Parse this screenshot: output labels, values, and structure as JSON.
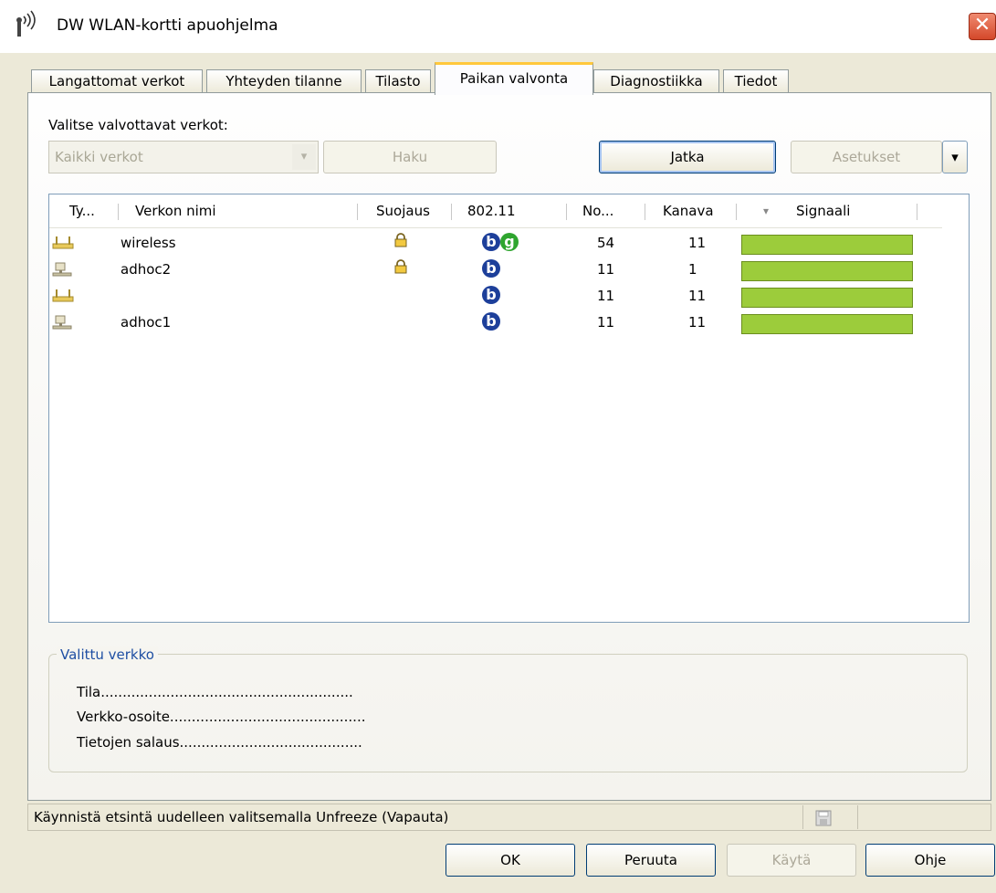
{
  "window": {
    "title": "DW WLAN-kortti apuohjelma",
    "close_icon": "✕"
  },
  "tabs": [
    {
      "label": "Langattomat verkot"
    },
    {
      "label": "Yhteyden tilanne"
    },
    {
      "label": "Tilasto"
    },
    {
      "label": "Paikan valvonta"
    },
    {
      "label": "Diagnostiikka"
    },
    {
      "label": "Tiedot"
    }
  ],
  "select_label": "Valitse valvottavat verkot:",
  "network_filter": {
    "value": "Kaikki verkot",
    "arrow": "▾"
  },
  "buttons": {
    "search": "Haku",
    "continue": "Jatka",
    "settings": "Asetukset",
    "settings_arrow": "▾"
  },
  "table": {
    "headers": [
      "Ty...",
      "Verkon nimi",
      "Suojaus",
      "802.11",
      "No...",
      "Kanava",
      "Signaali"
    ],
    "sort_arrow": "▾",
    "rows": [
      {
        "type": "infrastructure",
        "name": "wireless",
        "secured": true,
        "modes": [
          "b",
          "g"
        ],
        "rate": "54",
        "channel": "11",
        "signal": 1.0
      },
      {
        "type": "adhoc",
        "name": "adhoc2",
        "secured": true,
        "modes": [
          "b"
        ],
        "rate": "11",
        "channel": "1",
        "signal": 1.0
      },
      {
        "type": "infrastructure",
        "name": "",
        "secured": false,
        "modes": [
          "b"
        ],
        "rate": "11",
        "channel": "11",
        "signal": 1.0
      },
      {
        "type": "adhoc",
        "name": "adhoc1",
        "secured": false,
        "modes": [
          "b"
        ],
        "rate": "11",
        "channel": "11",
        "signal": 1.0
      }
    ]
  },
  "scrollbar": {
    "up": "▲",
    "down": "▼",
    "grip": "≡"
  },
  "selected_network": {
    "title": "Valittu verkko",
    "status_label": "Tila..........................................................",
    "address_label": "Verkko-osoite.............................................",
    "encryption_label": "Tietojen salaus.........................................."
  },
  "status_bar": {
    "text": "Käynnistä etsintä uudelleen valitsemalla Unfreeze (Vapauta)"
  },
  "footer": {
    "ok": "OK",
    "cancel": "Peruuta",
    "apply": "Käytä",
    "help": "Ohje"
  },
  "colors": {
    "signal": "#9ccc3b",
    "mode_b": "#1d3f9a",
    "mode_g": "#2fa52f",
    "active_tab_accent": "#ffc83c"
  }
}
